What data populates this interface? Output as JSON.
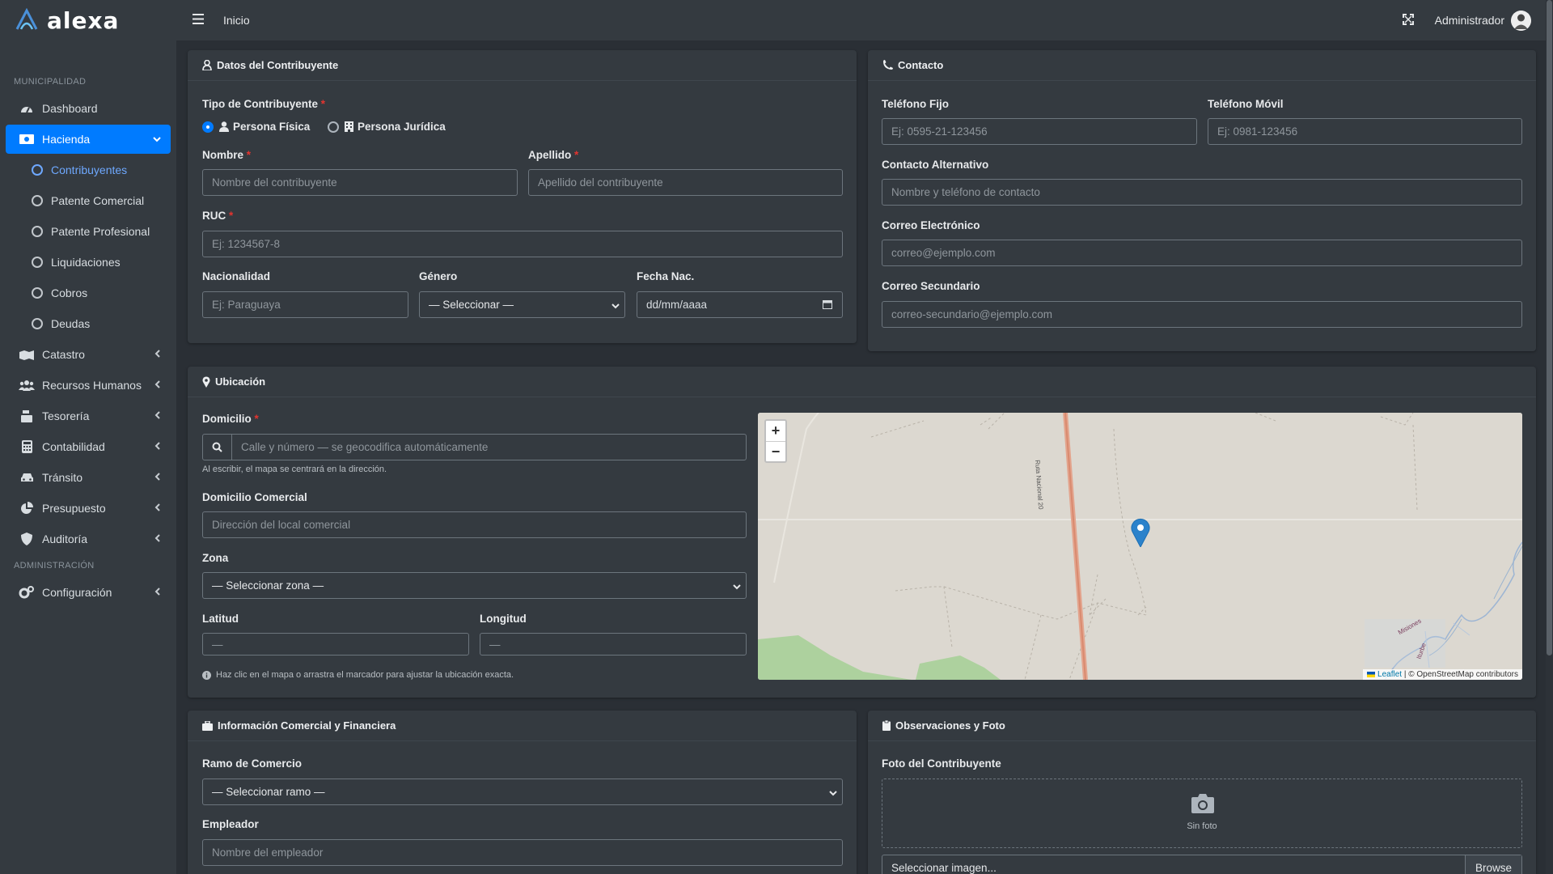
{
  "brand": {
    "name": "alexa"
  },
  "topbar": {
    "breadcrumb": "Inicio",
    "user": "Administrador"
  },
  "sidebar": {
    "section_municipalidad": "MUNICIPALIDAD",
    "section_administracion": "ADMINISTRACIÓN",
    "items": {
      "dashboard": "Dashboard",
      "hacienda": "Hacienda",
      "catastro": "Catastro",
      "recursos": "Recursos Humanos",
      "tesoreria": "Tesorería",
      "contabilidad": "Contabilidad",
      "transito": "Tránsito",
      "presupuesto": "Presupuesto",
      "auditoria": "Auditoría",
      "configuracion": "Configuración"
    },
    "sub": {
      "contribuyentes": "Contribuyentes",
      "patente_comercial": "Patente Comercial",
      "patente_profesional": "Patente Profesional",
      "liquidaciones": "Liquidaciones",
      "cobros": "Cobros",
      "deudas": "Deudas"
    }
  },
  "datos": {
    "title": "Datos del Contribuyente",
    "tipo_label": "Tipo de Contribuyente",
    "req": "*",
    "fisica": "Persona Física",
    "juridica": "Persona Jurídica",
    "nombre_label": "Nombre",
    "nombre_ph": "Nombre del contribuyente",
    "apellido_label": "Apellido",
    "apellido_ph": "Apellido del contribuyente",
    "ruc_label": "RUC",
    "ruc_ph": "Ej: 1234567-8",
    "nac_label": "Nacionalidad",
    "nac_ph": "Ej: Paraguaya",
    "genero_label": "Género",
    "genero_val": "— Seleccionar —",
    "fecha_label": "Fecha Nac.",
    "fecha_val": "dd/mm/aaaa"
  },
  "contacto": {
    "title": "Contacto",
    "fijo_label": "Teléfono Fijo",
    "fijo_ph": "Ej: 0595-21-123456",
    "movil_label": "Teléfono Móvil",
    "movil_ph": "Ej: 0981-123456",
    "alt_label": "Contacto Alternativo",
    "alt_ph": "Nombre y teléfono de contacto",
    "email_label": "Correo Electrónico",
    "email_ph": "correo@ejemplo.com",
    "email2_label": "Correo Secundario",
    "email2_ph": "correo-secundario@ejemplo.com"
  },
  "ubicacion": {
    "title": "Ubicación",
    "domicilio_label": "Domicilio",
    "domicilio_ph": "Calle y número — se geocodifica automáticamente",
    "domicilio_hint": "Al escribir, el mapa se centrará en la dirección.",
    "comercial_label": "Domicilio Comercial",
    "comercial_ph": "Dirección del local comercial",
    "zona_label": "Zona",
    "zona_val": "— Seleccionar zona —",
    "lat_label": "Latitud",
    "lat_val": "—",
    "lng_label": "Longitud",
    "lng_val": "—",
    "map_hint": "Haz clic en el mapa o arrastra el marcador para ajustar la ubicación exacta.",
    "map": {
      "zoom_in": "+",
      "zoom_out": "−",
      "road_label": "Ruta Nacional 20",
      "river_label": "Misiones",
      "river_label2": "Iturbe",
      "attr_leaflet": "Leaflet",
      "attr_osm": "| © OpenStreetMap contributors"
    }
  },
  "comercial": {
    "title": "Información Comercial y Financiera",
    "ramo_label": "Ramo de Comercio",
    "ramo_val": "— Seleccionar ramo —",
    "empleador_label": "Empleador",
    "empleador_ph": "Nombre del empleador"
  },
  "observaciones": {
    "title": "Observaciones y Foto",
    "foto_label": "Foto del Contribuyente",
    "sin_foto": "Sin foto",
    "file_text": "Seleccionar imagen...",
    "browse": "Browse"
  }
}
